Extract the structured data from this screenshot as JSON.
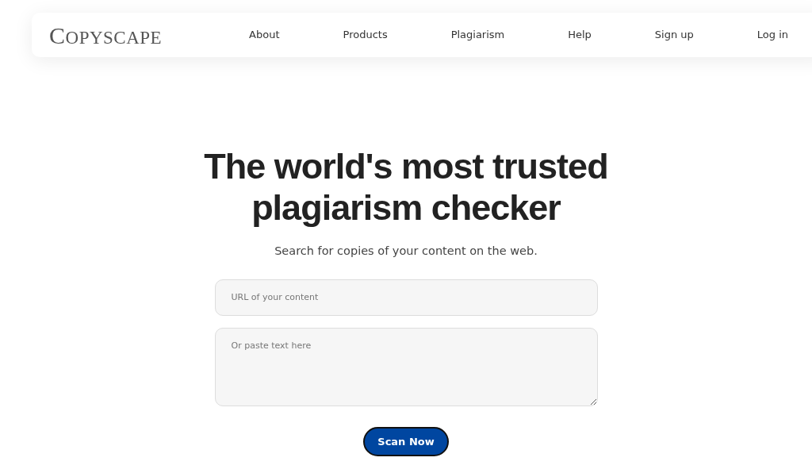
{
  "logo": "COPYSCAPE",
  "nav": [
    "About",
    "Products",
    "Plagiarism",
    "Help",
    "Sign up",
    "Log in"
  ],
  "heading": "The world's most trusted plagiarism checker",
  "subheading": "Search for copies of your content on the web.",
  "url_field": {
    "placeholder": "URL of your content"
  },
  "text_field": {
    "placeholder": "Or paste text here"
  },
  "button": "Scan Now"
}
